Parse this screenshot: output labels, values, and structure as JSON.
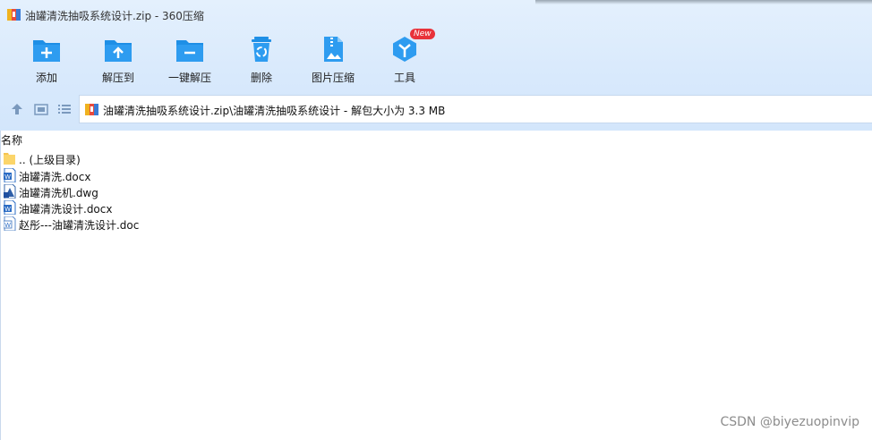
{
  "window": {
    "title": "油罐清洗抽吸系统设计.zip - 360压缩"
  },
  "toolbar": {
    "items": [
      {
        "label": "添加",
        "icon": "add-folder-icon"
      },
      {
        "label": "解压到",
        "icon": "extract-to-icon"
      },
      {
        "label": "一键解压",
        "icon": "one-click-extract-icon"
      },
      {
        "label": "删除",
        "icon": "recycle-bin-icon"
      },
      {
        "label": "图片压缩",
        "icon": "image-compress-icon"
      },
      {
        "label": "工具",
        "icon": "tools-icon",
        "badge": "New"
      }
    ]
  },
  "navigation": {
    "path": "油罐清洗抽吸系统设计.zip\\油罐清洗抽吸系统设计 - 解包大小为 3.3 MB"
  },
  "file_list": {
    "column_name": "名称",
    "items": [
      {
        "name": ".. (上级目录)",
        "type": "folder"
      },
      {
        "name": "油罐清洗.docx",
        "type": "docx"
      },
      {
        "name": "油罐清洗机.dwg",
        "type": "dwg"
      },
      {
        "name": "油罐清洗设计.docx",
        "type": "docx"
      },
      {
        "name": "赵彤---油罐清洗设计.doc",
        "type": "doc"
      }
    ]
  },
  "watermark": "CSDN @biyezuopinvip",
  "colors": {
    "accent": "#1e8fe6",
    "toolbar_bg": "#d8e9fc",
    "badge": "#e8323a"
  }
}
